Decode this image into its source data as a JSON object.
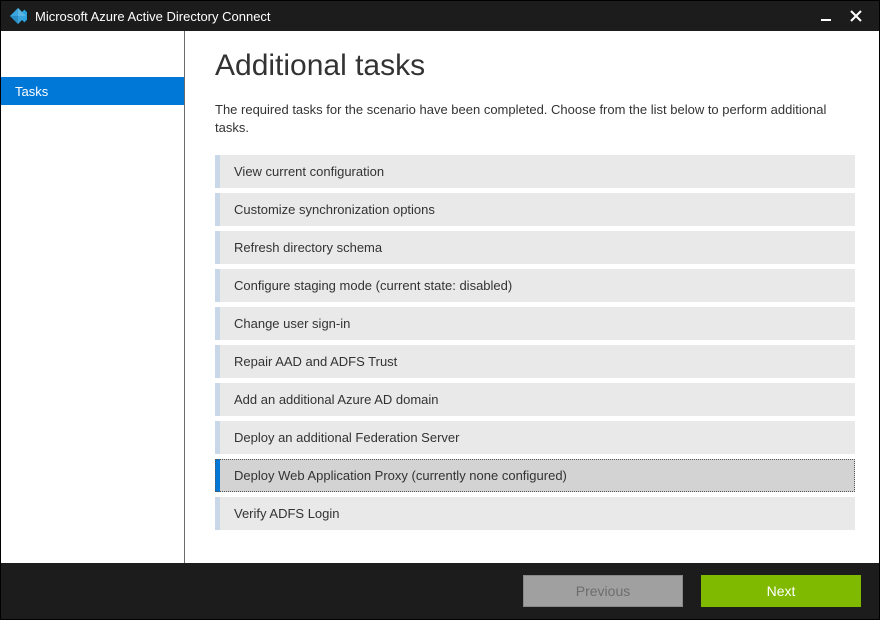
{
  "window": {
    "title": "Microsoft Azure Active Directory Connect"
  },
  "sidebar": {
    "items": [
      {
        "label": "Tasks",
        "selected": true
      }
    ]
  },
  "main": {
    "title": "Additional tasks",
    "description": "The required tasks for the scenario have been completed. Choose from the list below to perform additional tasks.",
    "tasks": [
      {
        "label": "View current configuration",
        "selected": false
      },
      {
        "label": "Customize synchronization options",
        "selected": false
      },
      {
        "label": "Refresh directory schema",
        "selected": false
      },
      {
        "label": "Configure staging mode (current state: disabled)",
        "selected": false
      },
      {
        "label": "Change user sign-in",
        "selected": false
      },
      {
        "label": "Repair AAD and ADFS Trust",
        "selected": false
      },
      {
        "label": "Add an additional Azure AD domain",
        "selected": false
      },
      {
        "label": "Deploy an additional Federation Server",
        "selected": false
      },
      {
        "label": "Deploy Web Application Proxy (currently none configured)",
        "selected": true
      },
      {
        "label": "Verify ADFS Login",
        "selected": false
      }
    ]
  },
  "footer": {
    "previous_label": "Previous",
    "next_label": "Next"
  }
}
